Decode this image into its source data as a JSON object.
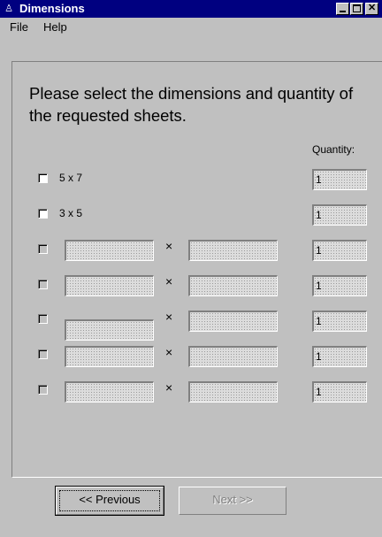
{
  "window": {
    "title": "Dimensions"
  },
  "menu": {
    "file": "File",
    "help": "Help"
  },
  "heading": "Please select the dimensions and quantity of the requested sheets.",
  "quantity_header": "Quantity:",
  "rows": [
    {
      "label": "5 x 7",
      "quantity": "1"
    },
    {
      "label": "3 x 5",
      "quantity": "1"
    },
    {
      "width": "",
      "height": "",
      "times": "×",
      "quantity": "1"
    },
    {
      "width": "",
      "height": "",
      "times": "×",
      "quantity": "1"
    },
    {
      "width": "",
      "height": "",
      "times": "×",
      "quantity": "1"
    },
    {
      "width": "",
      "height": "",
      "times": "×",
      "quantity": "1"
    },
    {
      "width": "",
      "height": "",
      "times": "×",
      "quantity": "1"
    }
  ],
  "buttons": {
    "previous": "<<  Previous",
    "next": "Next  >>"
  }
}
